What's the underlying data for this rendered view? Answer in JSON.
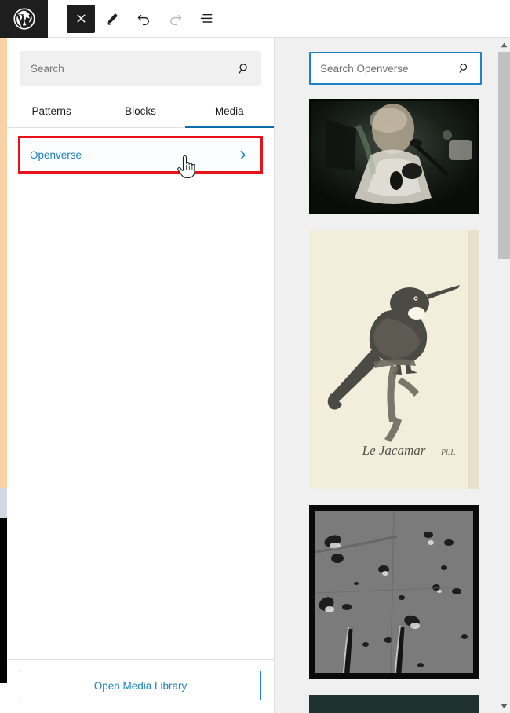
{
  "toolbar": {
    "logo_icon": "wordpress-logo-icon",
    "buttons": [
      {
        "name": "close-inserter-button",
        "icon": "close-x-icon",
        "label": "Close"
      },
      {
        "name": "edit-tool-button",
        "icon": "pencil-edit-icon",
        "label": "Edit"
      },
      {
        "name": "undo-button",
        "icon": "undo-arrow-icon",
        "label": "Undo"
      },
      {
        "name": "redo-button",
        "icon": "redo-arrow-icon",
        "label": "Redo"
      },
      {
        "name": "list-view-button",
        "icon": "list-view-icon",
        "label": "Document Overview"
      }
    ]
  },
  "inserter": {
    "search": {
      "placeholder": "Search",
      "value": "",
      "icon": "search-icon"
    },
    "tabs": [
      {
        "label": "Patterns",
        "active": false
      },
      {
        "label": "Blocks",
        "active": false
      },
      {
        "label": "Media",
        "active": true
      }
    ],
    "sources": [
      {
        "label": "Openverse",
        "chevron_icon": "chevron-right-icon",
        "highlighted": true
      }
    ],
    "footer": {
      "media_library_label": "Open Media Library"
    },
    "cursor": "pointer-hand-cursor"
  },
  "media_panel": {
    "search": {
      "placeholder": "Search Openverse",
      "value": "",
      "icon": "search-icon"
    },
    "thumbnails": [
      {
        "alt": "Astronaut in spacecraft dim interior photograph",
        "type": "photo-dark"
      },
      {
        "alt": "Le Jacamar vintage bird engraving on aged paper",
        "type": "engraving-bird"
      },
      {
        "alt": "Grayscale lunar cratered surface photograph",
        "type": "photo-lunar"
      },
      {
        "alt": "Partially visible dark green photograph",
        "type": "photo-dark-green"
      }
    ]
  },
  "scrollbar": {
    "up_icon": "scroll-up-arrow-icon",
    "down_icon": "scroll-down-arrow-icon"
  },
  "colors": {
    "accent_blue": "#1c82c4",
    "tab_underline": "#0b6ea8",
    "annotation_red": "#e8121a",
    "dark": "#1e1e1e",
    "panel_gray": "#f0f0f0"
  }
}
